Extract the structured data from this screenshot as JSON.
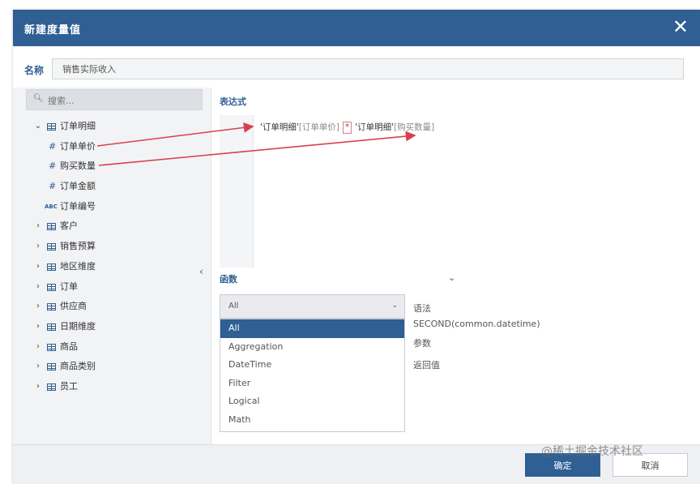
{
  "dialog": {
    "title": "新建度量值",
    "close_glyph": "✕"
  },
  "name": {
    "label": "名称",
    "value": "销售实际收入"
  },
  "search": {
    "placeholder": "搜索..."
  },
  "tree": {
    "group": "订单明细",
    "fields": [
      {
        "type": "#",
        "label": "订单单价"
      },
      {
        "type": "#",
        "label": "购买数量"
      },
      {
        "type": "#",
        "label": "订单金额"
      },
      {
        "type": "ABC",
        "label": "订单编号"
      }
    ],
    "tables": [
      "客户",
      "销售预算",
      "地区维度",
      "订单",
      "供应商",
      "日期维度",
      "商品",
      "商品类别",
      "员工"
    ]
  },
  "expression": {
    "label": "表达式",
    "part1_table": "'订单明细'",
    "part1_col": "[订单单价]",
    "operator": "*",
    "part2_table": "'订单明细'",
    "part2_col": "[购买数量]"
  },
  "functions": {
    "label": "函数",
    "selected": "All",
    "options": [
      "All",
      "Aggregation",
      "DateTime",
      "Filter",
      "Logical",
      "Math"
    ],
    "syntax_label": "语法",
    "syntax_value": "SECOND(common.datetime)",
    "params_label": "参数",
    "return_label": "返回值"
  },
  "footer": {
    "ok_label": "确定",
    "cancel_label": "取消",
    "watermark": "@稀土掘金技术社区"
  },
  "colors": {
    "header": "#2f5f93",
    "arrow": "#d9404f",
    "selected_option": "#2f5f93"
  }
}
